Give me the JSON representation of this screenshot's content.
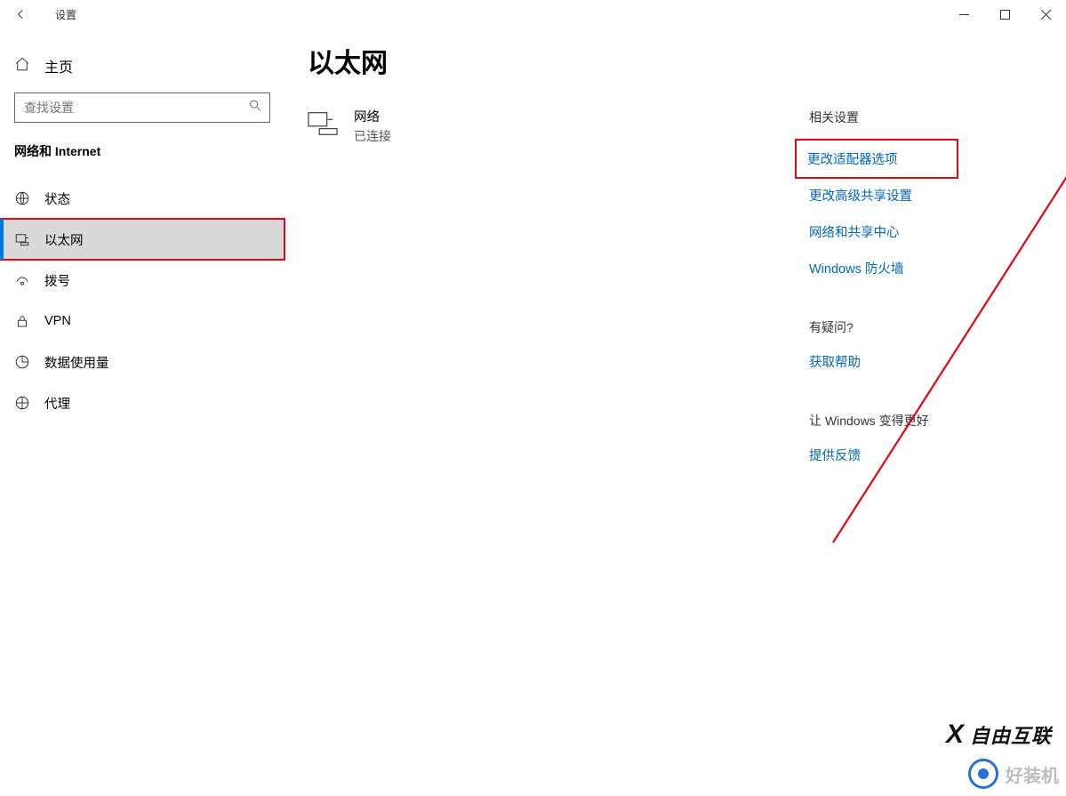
{
  "window": {
    "title": "设置"
  },
  "sidebar": {
    "home": "主页",
    "search_placeholder": "查找设置",
    "category": "网络和 Internet",
    "items": [
      {
        "label": "状态"
      },
      {
        "label": "以太网"
      },
      {
        "label": "拨号"
      },
      {
        "label": "VPN"
      },
      {
        "label": "数据使用量"
      },
      {
        "label": "代理"
      }
    ]
  },
  "main": {
    "page_title": "以太网",
    "network": {
      "name": "网络",
      "status": "已连接"
    }
  },
  "right": {
    "related_heading": "相关设置",
    "links": [
      "更改适配器选项",
      "更改高级共享设置",
      "网络和共享中心",
      "Windows 防火墙"
    ],
    "question_heading": "有疑问?",
    "help_link": "获取帮助",
    "better_heading": "让 Windows 变得更好",
    "feedback_link": "提供反馈"
  },
  "watermarks": {
    "wm1": "自由互联",
    "wm2": "好装机"
  }
}
